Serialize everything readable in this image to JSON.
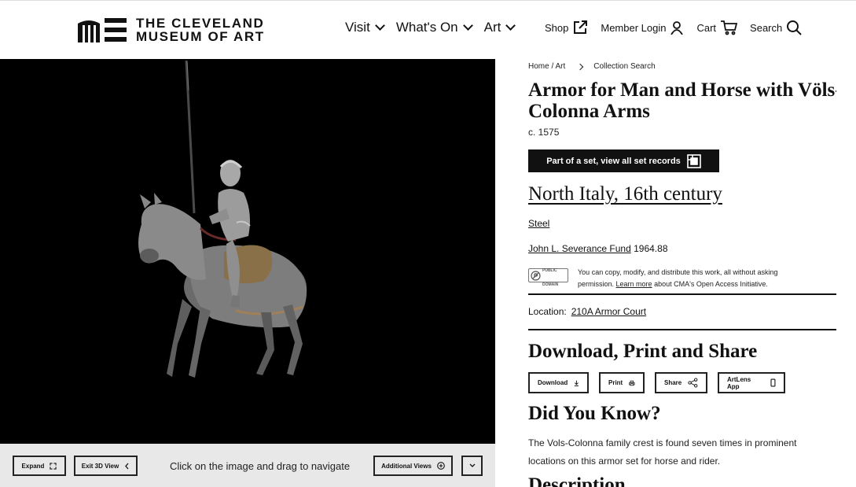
{
  "header": {
    "logo_line1": "THE CLEVELAND",
    "logo_line2": "MUSEUM OF ART",
    "nav": [
      {
        "label": "Visit"
      },
      {
        "label": "What's On"
      },
      {
        "label": "Art"
      }
    ],
    "shop": "Shop",
    "member_login": "Member Login",
    "cart": "Cart",
    "search": "Search"
  },
  "viewer": {
    "expand_label": "Expand",
    "exit_3d_label": "Exit 3D View",
    "hint": "Click on the image and drag to navigate",
    "additional_views_label": "Additional Views"
  },
  "artwork": {
    "breadcrumb_home": "Home / Art",
    "breadcrumb_current": "Collection Search",
    "title": "Armor for Man and Horse with Völs-Colonna Arms",
    "date": "c. 1575",
    "set_button": "Part of a set, view all set records",
    "culture": "North Italy, 16th century",
    "medium": "Steel",
    "credit_fund": "John L. Severance Fund",
    "accession": "1964.88",
    "pd_badge_line1": "PUBLIC",
    "pd_badge_line2": "DOMAIN",
    "pd_text_before": "You can copy, modify, and distribute this work, all without asking permission.",
    "pd_learn_more": "Learn more",
    "pd_text_after": "about CMA's Open Access Initiative.",
    "location_label": "Location:",
    "location_value": "210A Armor Court"
  },
  "download": {
    "heading": "Download, Print and Share",
    "buttons": [
      "Download",
      "Print",
      "Share",
      "ArtLens App"
    ]
  },
  "did_you_know": {
    "heading": "Did You Know?",
    "text": "The Vols-Colonna family crest is found seven times in prominent locations on this armor set for horse and rider."
  },
  "description": {
    "heading": "Description"
  }
}
